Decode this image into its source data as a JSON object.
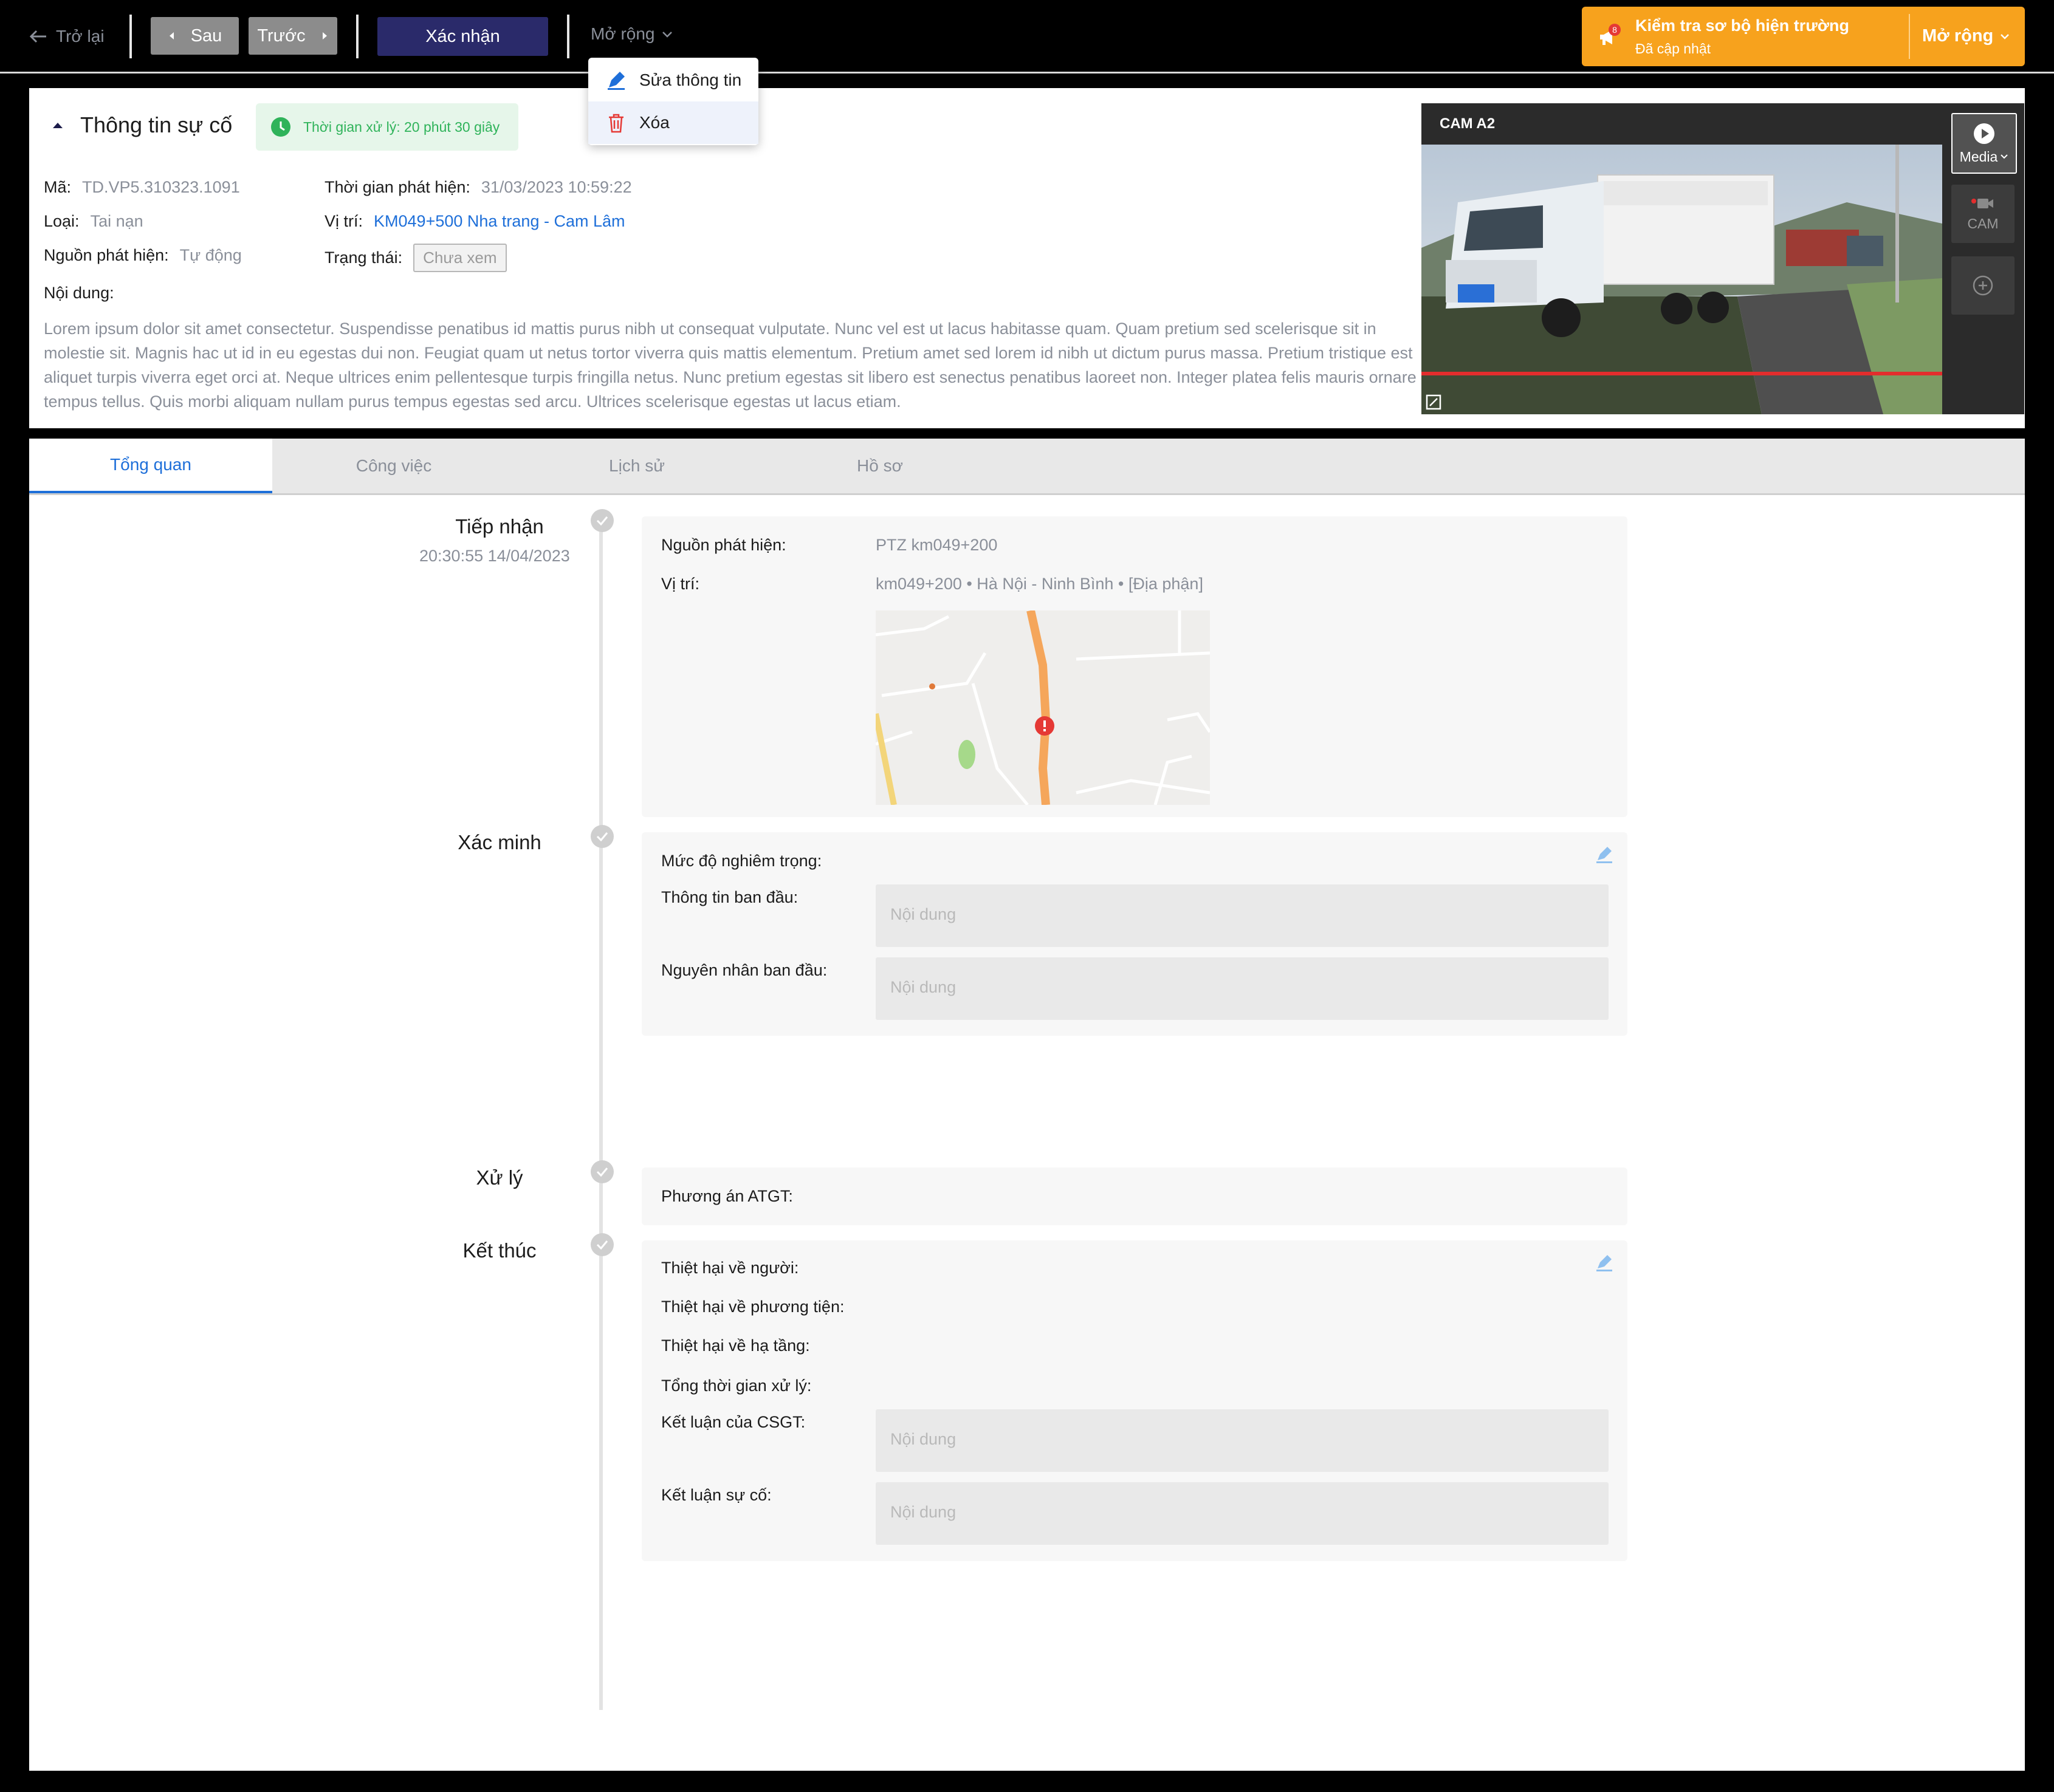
{
  "topbar": {
    "back_label": "Trở lại",
    "prev_label": "Sau",
    "next_label": "Trước",
    "confirm_label": "Xác nhận",
    "expand_label": "Mở rộng",
    "notification": {
      "badge_count": "8",
      "title": "Kiểm tra sơ bộ hiện trường",
      "subtitle": "Đã cập nhật",
      "more_label": "Mở rộng",
      "color": "#f7a21d"
    }
  },
  "dropdown": {
    "items": [
      {
        "label": "Sửa thông tin",
        "icon": "pencil-icon"
      },
      {
        "label": "Xóa",
        "icon": "trash-icon"
      }
    ]
  },
  "incident": {
    "title": "Thông tin sự cố",
    "processing_time": "Thời gian xử lý: 20 phút 30 giây",
    "code_label": "Mã:",
    "code_value": "TD.VP5.310323.1091",
    "type_label": "Loại:",
    "type_value": "Tai nạn",
    "source_label": "Nguồn phát hiện:",
    "source_value": "Tự động",
    "detected_label": "Thời gian phát hiện:",
    "detected_value": "31/03/2023 10:59:22",
    "location_label": "Vị trí:",
    "location_value": "KM049+500 Nha trang - Cam Lâm",
    "status_label": "Trạng thái:",
    "status_value": "Chưa xem",
    "content_label": "Nội dung:",
    "description": "Lorem ipsum dolor sit amet consectetur. Suspendisse penatibus id mattis purus nibh ut consequat vulputate. Nunc vel est ut lacus habitasse quam. Quam pretium sed scelerisque sit in molestie sit. Magnis hac ut id in eu egestas dui non. Feugiat quam ut netus tortor viverra quis mattis elementum. Pretium amet sed lorem id nibh ut dictum purus massa. Pretium tristique est aliquet turpis viverra eget orci at. Neque ultrices enim pellentesque turpis fringilla netus. Nunc pretium egestas sit libero est senectus penatibus laoreet non. Integer platea felis mauris ornare tempus tellus. Quis morbi aliquam nullam purus tempus egestas sed arcu. Ultrices scelerisque egestas ut lacus etiam."
  },
  "camera": {
    "label": "CAM A2",
    "media_label": "Media",
    "cam_label": "CAM"
  },
  "tabs": [
    "Tổng quan",
    "Công việc",
    "Lịch sử",
    "Hồ sơ"
  ],
  "timeline": {
    "receive": {
      "title": "Tiếp nhận",
      "time": "20:30:55 14/04/2023",
      "source_label": "Nguồn phát hiện:",
      "source_value": "PTZ km049+200",
      "location_label": "Vị trí:",
      "location_value": "km049+200 • Hà Nội - Ninh Bình • [Địa phận]"
    },
    "verify": {
      "title": "Xác minh",
      "severity_label": "Mức độ nghiêm trọng:",
      "initial_info_label": "Thông tin ban đầu:",
      "initial_cause_label": "Nguyên nhân ban đầu:",
      "placeholder": "Nội dung"
    },
    "handle": {
      "title": "Xử lý",
      "plan_label": "Phương án ATGT:"
    },
    "finish": {
      "title": "Kết thúc",
      "human_damage_label": "Thiệt hại về người:",
      "vehicle_damage_label": "Thiệt hại về phương tiện:",
      "infra_damage_label": "Thiệt hại về hạ tầng:",
      "total_time_label": "Tổng thời gian xử lý:",
      "csgt_conclusion_label": "Kết luận của CSGT:",
      "incident_conclusion_label": "Kết luận sự cố:",
      "placeholder": "Nội dung"
    }
  }
}
